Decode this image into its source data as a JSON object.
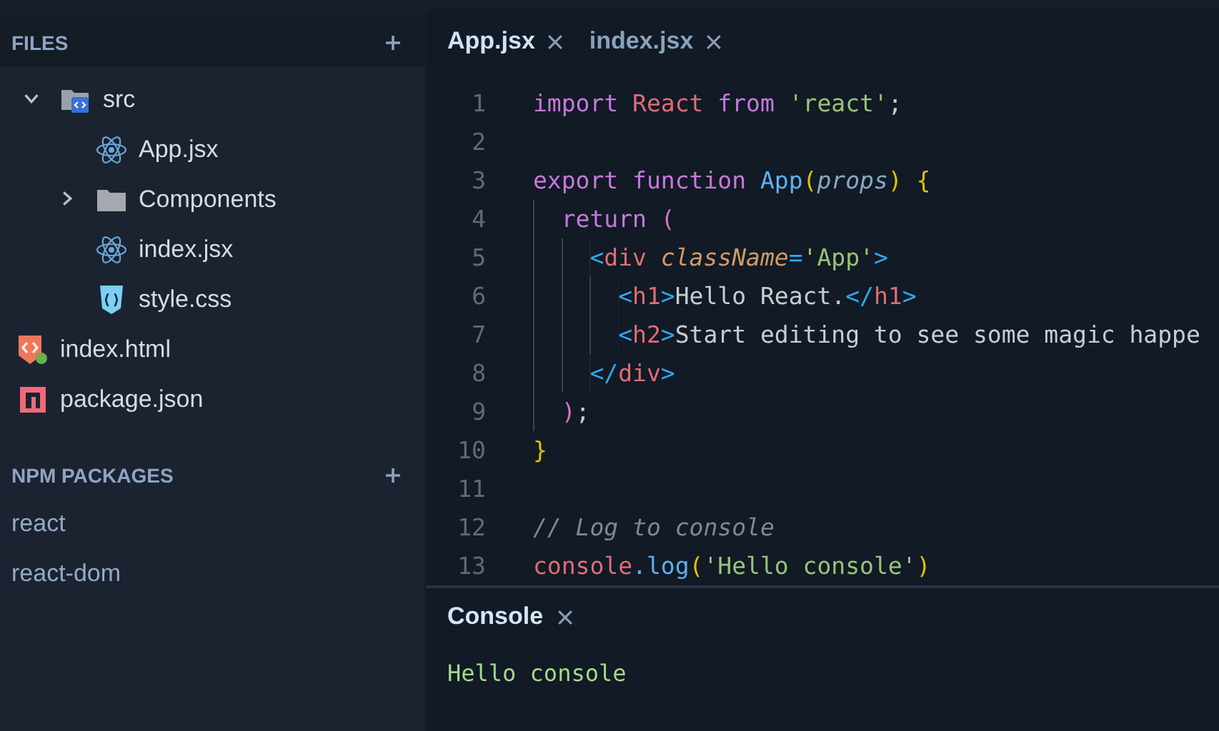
{
  "sidebar": {
    "files": {
      "title": "FILES",
      "tree": [
        {
          "name": "src",
          "kind": "src-folder",
          "expanded": true,
          "children": [
            {
              "name": "App.jsx",
              "kind": "react"
            },
            {
              "name": "Components",
              "kind": "folder",
              "expanded": false
            },
            {
              "name": "index.jsx",
              "kind": "react"
            },
            {
              "name": "style.css",
              "kind": "css"
            }
          ]
        },
        {
          "name": "index.html",
          "kind": "html"
        },
        {
          "name": "package.json",
          "kind": "npm"
        }
      ]
    },
    "packages": {
      "title": "NPM PACKAGES",
      "items": [
        "react",
        "react-dom"
      ]
    }
  },
  "tabs": [
    {
      "label": "App.jsx",
      "selected": true
    },
    {
      "label": "index.jsx",
      "selected": false
    }
  ],
  "code": [
    {
      "n": "1",
      "tokens": [
        {
          "t": "import ",
          "kind": "kw"
        },
        {
          "t": "React ",
          "kind": "var"
        },
        {
          "t": "from ",
          "kind": "kw"
        },
        {
          "t": "'react'",
          "kind": "str"
        },
        {
          "t": ";",
          "kind": "plain"
        }
      ]
    },
    {
      "n": "2"
    },
    {
      "n": "3",
      "tokens": [
        {
          "t": "export function ",
          "kind": "kw"
        },
        {
          "t": "App",
          "kind": "fn"
        },
        {
          "t": "(",
          "kind": "brace"
        },
        {
          "t": "props",
          "kind": "param"
        },
        {
          "t": ") {",
          "kind": "brace"
        }
      ]
    },
    {
      "n": "4",
      "tokens": [
        {
          "t": "  return ",
          "kind": "kw"
        },
        {
          "t": "(",
          "kind": "paren"
        }
      ]
    },
    {
      "n": "5",
      "tokens": [
        {
          "t": "    <",
          "kind": "tag"
        },
        {
          "t": "div ",
          "kind": "tagname"
        },
        {
          "t": "className",
          "kind": "attr"
        },
        {
          "t": "=",
          "kind": "tag"
        },
        {
          "t": "'App'",
          "kind": "str"
        },
        {
          "t": ">",
          "kind": "tag"
        }
      ]
    },
    {
      "n": "6",
      "tokens": [
        {
          "t": "      <",
          "kind": "tag"
        },
        {
          "t": "h1",
          "kind": "tagname"
        },
        {
          "t": ">",
          "kind": "tag"
        },
        {
          "t": "Hello React.",
          "kind": "plain"
        },
        {
          "t": "</",
          "kind": "tag"
        },
        {
          "t": "h1",
          "kind": "tagname"
        },
        {
          "t": ">",
          "kind": "tag"
        }
      ]
    },
    {
      "n": "7",
      "tokens": [
        {
          "t": "      <",
          "kind": "tag"
        },
        {
          "t": "h2",
          "kind": "tagname"
        },
        {
          "t": ">",
          "kind": "tag"
        },
        {
          "t": "Start editing to see some magic happe",
          "kind": "plain"
        }
      ]
    },
    {
      "n": "8",
      "tokens": [
        {
          "t": "    </",
          "kind": "tag"
        },
        {
          "t": "div",
          "kind": "tagname"
        },
        {
          "t": ">",
          "kind": "tag"
        }
      ]
    },
    {
      "n": "9",
      "tokens": [
        {
          "t": "  )",
          "kind": "paren"
        },
        {
          "t": ";",
          "kind": "plain"
        }
      ]
    },
    {
      "n": "10",
      "tokens": [
        {
          "t": "}",
          "kind": "brace"
        }
      ]
    },
    {
      "n": "11"
    },
    {
      "n": "12",
      "tokens": [
        {
          "t": "// Log to console",
          "kind": "comment"
        }
      ]
    },
    {
      "n": "13",
      "tokens": [
        {
          "t": "console",
          "kind": "var"
        },
        {
          "t": ".log",
          "kind": "fn"
        },
        {
          "t": "(",
          "kind": "brace"
        },
        {
          "t": "'Hello console'",
          "kind": "str"
        },
        {
          "t": ")",
          "kind": "brace"
        }
      ]
    }
  ],
  "console": {
    "tab": "Console",
    "output": "Hello console"
  }
}
